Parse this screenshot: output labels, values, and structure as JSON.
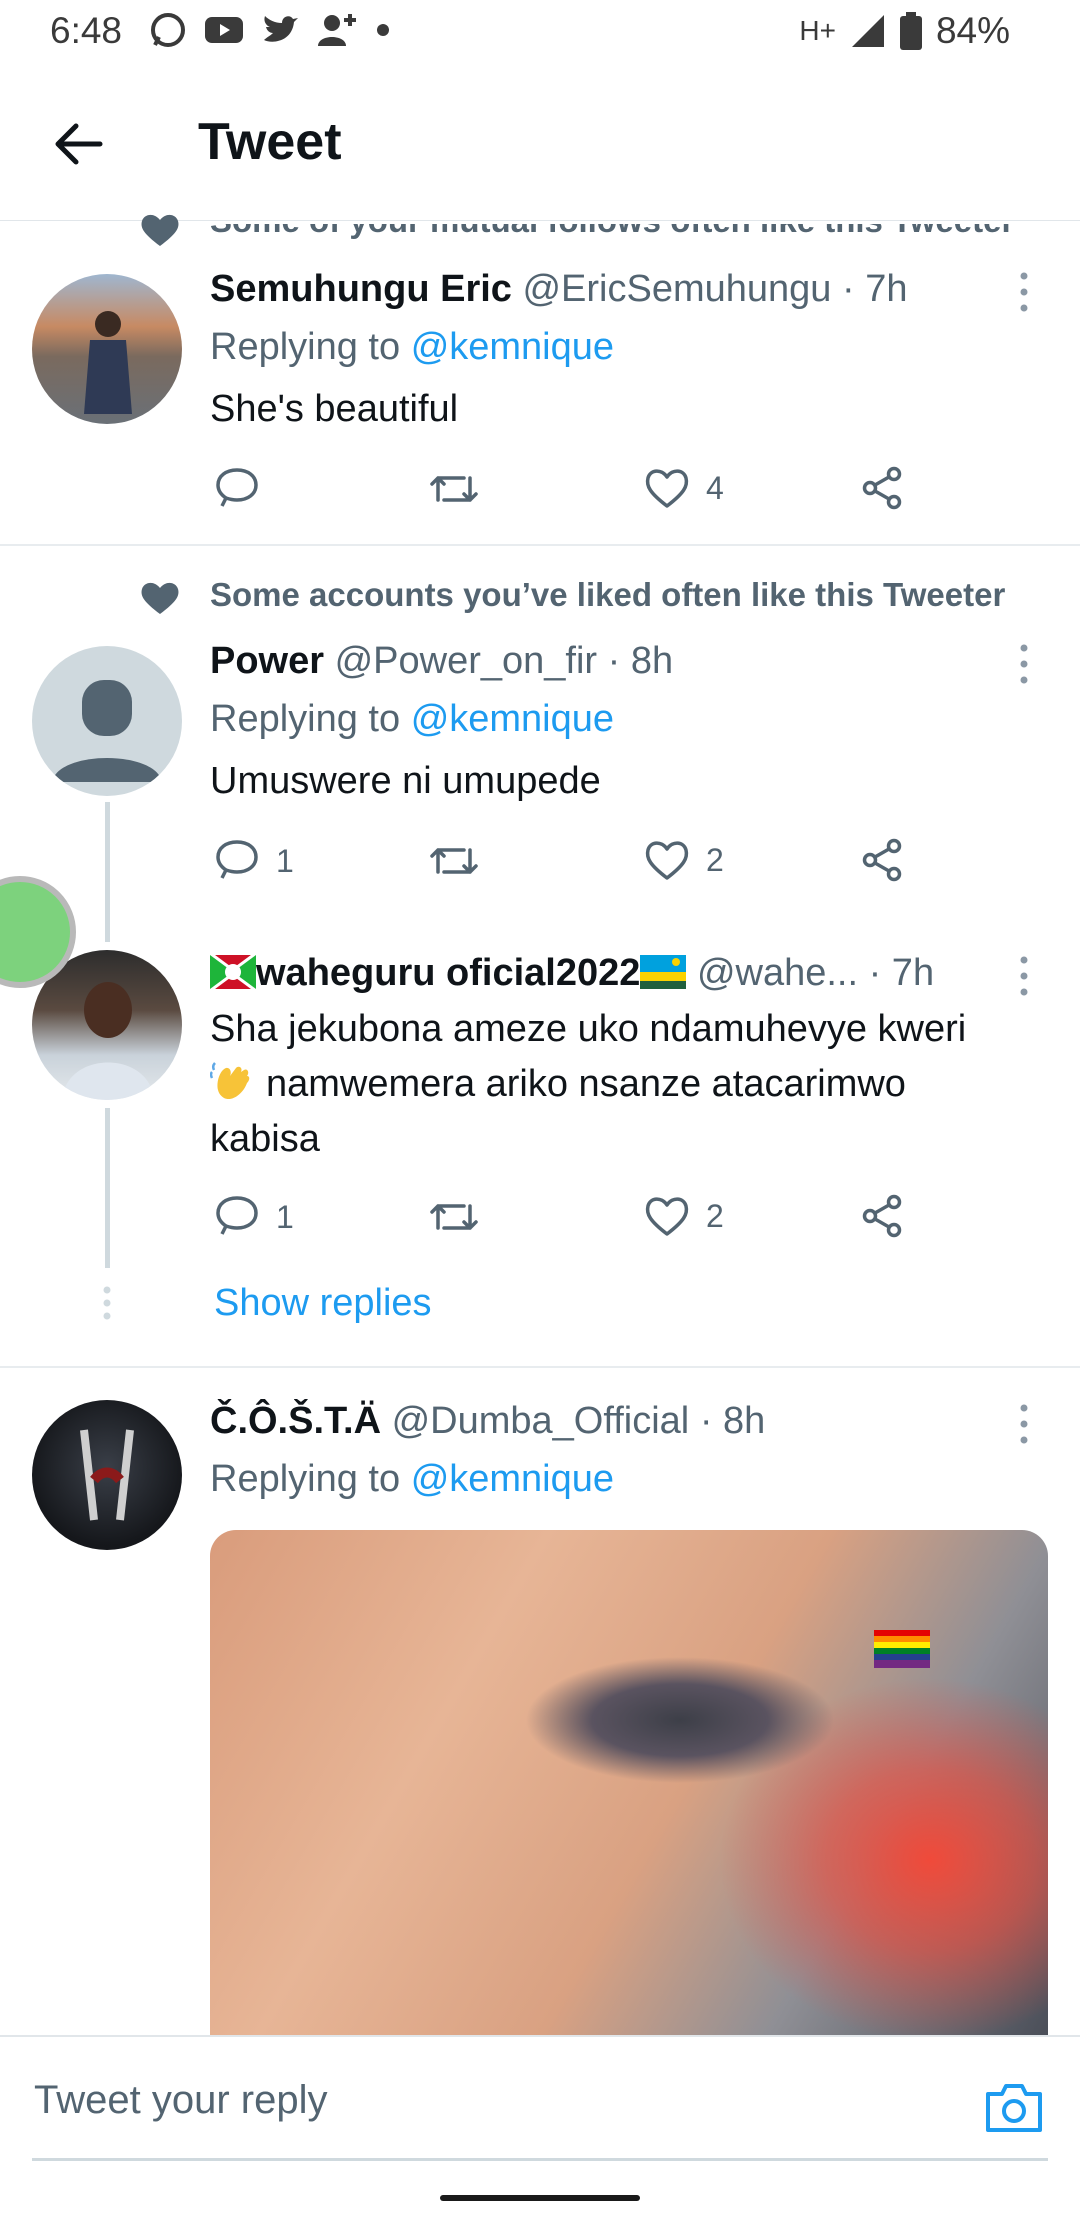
{
  "status_bar": {
    "time": "6:48",
    "left_icons": [
      "whatsapp-icon",
      "youtube-icon",
      "twitter-icon",
      "add-person-icon",
      "dot-icon"
    ],
    "network": "H+",
    "battery": "84%"
  },
  "header": {
    "title": "Tweet"
  },
  "tweets": [
    {
      "context": "Some of your mutual follows often like this Tweeter",
      "name": "Semuhungu Eric",
      "handle": "@EricSemuhungu",
      "time": "· 7h",
      "replying_prefix": "Replying to",
      "mention": "@kemnique",
      "text": "She's beautiful",
      "replies": "",
      "likes": "4"
    },
    {
      "context": "Some accounts you’ve liked often like this Tweeter",
      "name": "Power",
      "handle": "@Power_on_fir",
      "time": "· 8h",
      "replying_prefix": "Replying to",
      "mention": "@kemnique",
      "text": "Umuswere ni umupede",
      "replies": "1",
      "likes": "2"
    },
    {
      "name": "waheguru oficial2022",
      "handle": "@wahe...",
      "time": "· 7h",
      "text_line1": "Sha jekubona ameze uko ndamuhevye kweri",
      "text_line2": "namwemera ariko nsanze atacarimwo",
      "text_line3": "kabisa",
      "replies": "1",
      "likes": "2",
      "show_replies": "Show replies"
    },
    {
      "name": "Č.Ô.Š.T.Ä",
      "handle": "@Dumba_Official",
      "time": "· 8h",
      "replying_prefix": "Replying to",
      "mention": "@kemnique"
    }
  ],
  "composer": {
    "placeholder": "Tweet your reply"
  },
  "colors": {
    "link": "#1d9bf0",
    "muted": "#536471",
    "text": "#0f1419"
  }
}
